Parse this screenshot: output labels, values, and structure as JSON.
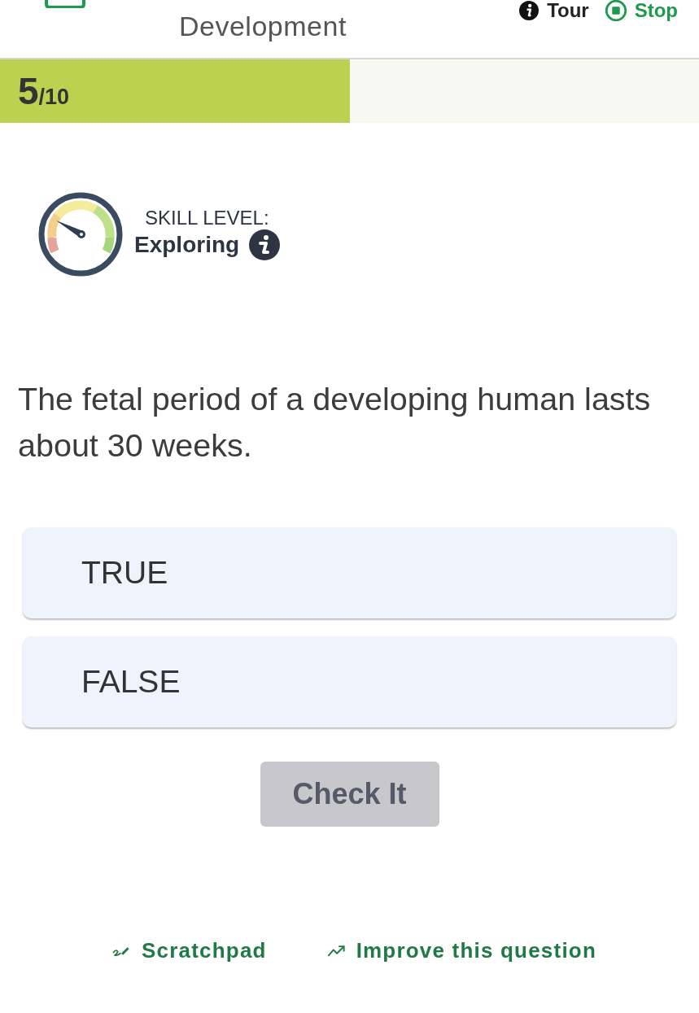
{
  "header": {
    "title": "Development",
    "tour_label": "Tour",
    "stop_label": "Stop"
  },
  "progress": {
    "current": "5",
    "total": "/10",
    "level": 0.5
  },
  "skill": {
    "caption": "SKILL LEVEL:",
    "value": "Exploring"
  },
  "question": {
    "text": "The fetal period of a developing human lasts about 30 weeks."
  },
  "options": [
    {
      "label": "TRUE",
      "selected": false
    },
    {
      "label": "FALSE",
      "selected": false
    }
  ],
  "check_button": {
    "label": "Check It",
    "disabled": true
  },
  "footer_links": [
    {
      "label": "Scratchpad",
      "kind": "scratchpad"
    },
    {
      "label": "Improve this question",
      "kind": "improve"
    }
  ]
}
